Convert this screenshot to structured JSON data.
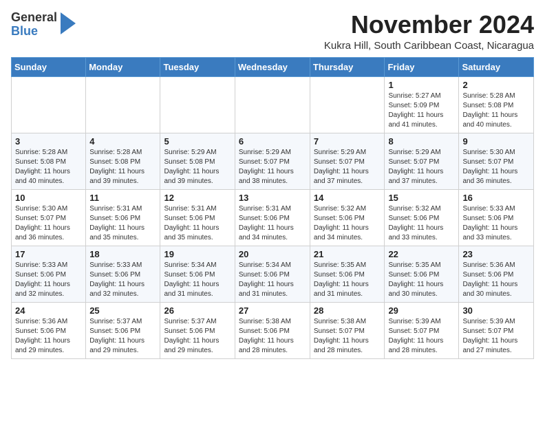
{
  "header": {
    "logo_general": "General",
    "logo_blue": "Blue",
    "month_year": "November 2024",
    "location": "Kukra Hill, South Caribbean Coast, Nicaragua"
  },
  "days_of_week": [
    "Sunday",
    "Monday",
    "Tuesday",
    "Wednesday",
    "Thursday",
    "Friday",
    "Saturday"
  ],
  "weeks": [
    [
      {
        "day": "",
        "sunrise": "",
        "sunset": "",
        "daylight": ""
      },
      {
        "day": "",
        "sunrise": "",
        "sunset": "",
        "daylight": ""
      },
      {
        "day": "",
        "sunrise": "",
        "sunset": "",
        "daylight": ""
      },
      {
        "day": "",
        "sunrise": "",
        "sunset": "",
        "daylight": ""
      },
      {
        "day": "",
        "sunrise": "",
        "sunset": "",
        "daylight": ""
      },
      {
        "day": "1",
        "sunrise": "Sunrise: 5:27 AM",
        "sunset": "Sunset: 5:09 PM",
        "daylight": "Daylight: 11 hours and 41 minutes."
      },
      {
        "day": "2",
        "sunrise": "Sunrise: 5:28 AM",
        "sunset": "Sunset: 5:08 PM",
        "daylight": "Daylight: 11 hours and 40 minutes."
      }
    ],
    [
      {
        "day": "3",
        "sunrise": "Sunrise: 5:28 AM",
        "sunset": "Sunset: 5:08 PM",
        "daylight": "Daylight: 11 hours and 40 minutes."
      },
      {
        "day": "4",
        "sunrise": "Sunrise: 5:28 AM",
        "sunset": "Sunset: 5:08 PM",
        "daylight": "Daylight: 11 hours and 39 minutes."
      },
      {
        "day": "5",
        "sunrise": "Sunrise: 5:29 AM",
        "sunset": "Sunset: 5:08 PM",
        "daylight": "Daylight: 11 hours and 39 minutes."
      },
      {
        "day": "6",
        "sunrise": "Sunrise: 5:29 AM",
        "sunset": "Sunset: 5:07 PM",
        "daylight": "Daylight: 11 hours and 38 minutes."
      },
      {
        "day": "7",
        "sunrise": "Sunrise: 5:29 AM",
        "sunset": "Sunset: 5:07 PM",
        "daylight": "Daylight: 11 hours and 37 minutes."
      },
      {
        "day": "8",
        "sunrise": "Sunrise: 5:29 AM",
        "sunset": "Sunset: 5:07 PM",
        "daylight": "Daylight: 11 hours and 37 minutes."
      },
      {
        "day": "9",
        "sunrise": "Sunrise: 5:30 AM",
        "sunset": "Sunset: 5:07 PM",
        "daylight": "Daylight: 11 hours and 36 minutes."
      }
    ],
    [
      {
        "day": "10",
        "sunrise": "Sunrise: 5:30 AM",
        "sunset": "Sunset: 5:07 PM",
        "daylight": "Daylight: 11 hours and 36 minutes."
      },
      {
        "day": "11",
        "sunrise": "Sunrise: 5:31 AM",
        "sunset": "Sunset: 5:06 PM",
        "daylight": "Daylight: 11 hours and 35 minutes."
      },
      {
        "day": "12",
        "sunrise": "Sunrise: 5:31 AM",
        "sunset": "Sunset: 5:06 PM",
        "daylight": "Daylight: 11 hours and 35 minutes."
      },
      {
        "day": "13",
        "sunrise": "Sunrise: 5:31 AM",
        "sunset": "Sunset: 5:06 PM",
        "daylight": "Daylight: 11 hours and 34 minutes."
      },
      {
        "day": "14",
        "sunrise": "Sunrise: 5:32 AM",
        "sunset": "Sunset: 5:06 PM",
        "daylight": "Daylight: 11 hours and 34 minutes."
      },
      {
        "day": "15",
        "sunrise": "Sunrise: 5:32 AM",
        "sunset": "Sunset: 5:06 PM",
        "daylight": "Daylight: 11 hours and 33 minutes."
      },
      {
        "day": "16",
        "sunrise": "Sunrise: 5:33 AM",
        "sunset": "Sunset: 5:06 PM",
        "daylight": "Daylight: 11 hours and 33 minutes."
      }
    ],
    [
      {
        "day": "17",
        "sunrise": "Sunrise: 5:33 AM",
        "sunset": "Sunset: 5:06 PM",
        "daylight": "Daylight: 11 hours and 32 minutes."
      },
      {
        "day": "18",
        "sunrise": "Sunrise: 5:33 AM",
        "sunset": "Sunset: 5:06 PM",
        "daylight": "Daylight: 11 hours and 32 minutes."
      },
      {
        "day": "19",
        "sunrise": "Sunrise: 5:34 AM",
        "sunset": "Sunset: 5:06 PM",
        "daylight": "Daylight: 11 hours and 31 minutes."
      },
      {
        "day": "20",
        "sunrise": "Sunrise: 5:34 AM",
        "sunset": "Sunset: 5:06 PM",
        "daylight": "Daylight: 11 hours and 31 minutes."
      },
      {
        "day": "21",
        "sunrise": "Sunrise: 5:35 AM",
        "sunset": "Sunset: 5:06 PM",
        "daylight": "Daylight: 11 hours and 31 minutes."
      },
      {
        "day": "22",
        "sunrise": "Sunrise: 5:35 AM",
        "sunset": "Sunset: 5:06 PM",
        "daylight": "Daylight: 11 hours and 30 minutes."
      },
      {
        "day": "23",
        "sunrise": "Sunrise: 5:36 AM",
        "sunset": "Sunset: 5:06 PM",
        "daylight": "Daylight: 11 hours and 30 minutes."
      }
    ],
    [
      {
        "day": "24",
        "sunrise": "Sunrise: 5:36 AM",
        "sunset": "Sunset: 5:06 PM",
        "daylight": "Daylight: 11 hours and 29 minutes."
      },
      {
        "day": "25",
        "sunrise": "Sunrise: 5:37 AM",
        "sunset": "Sunset: 5:06 PM",
        "daylight": "Daylight: 11 hours and 29 minutes."
      },
      {
        "day": "26",
        "sunrise": "Sunrise: 5:37 AM",
        "sunset": "Sunset: 5:06 PM",
        "daylight": "Daylight: 11 hours and 29 minutes."
      },
      {
        "day": "27",
        "sunrise": "Sunrise: 5:38 AM",
        "sunset": "Sunset: 5:06 PM",
        "daylight": "Daylight: 11 hours and 28 minutes."
      },
      {
        "day": "28",
        "sunrise": "Sunrise: 5:38 AM",
        "sunset": "Sunset: 5:07 PM",
        "daylight": "Daylight: 11 hours and 28 minutes."
      },
      {
        "day": "29",
        "sunrise": "Sunrise: 5:39 AM",
        "sunset": "Sunset: 5:07 PM",
        "daylight": "Daylight: 11 hours and 28 minutes."
      },
      {
        "day": "30",
        "sunrise": "Sunrise: 5:39 AM",
        "sunset": "Sunset: 5:07 PM",
        "daylight": "Daylight: 11 hours and 27 minutes."
      }
    ]
  ]
}
